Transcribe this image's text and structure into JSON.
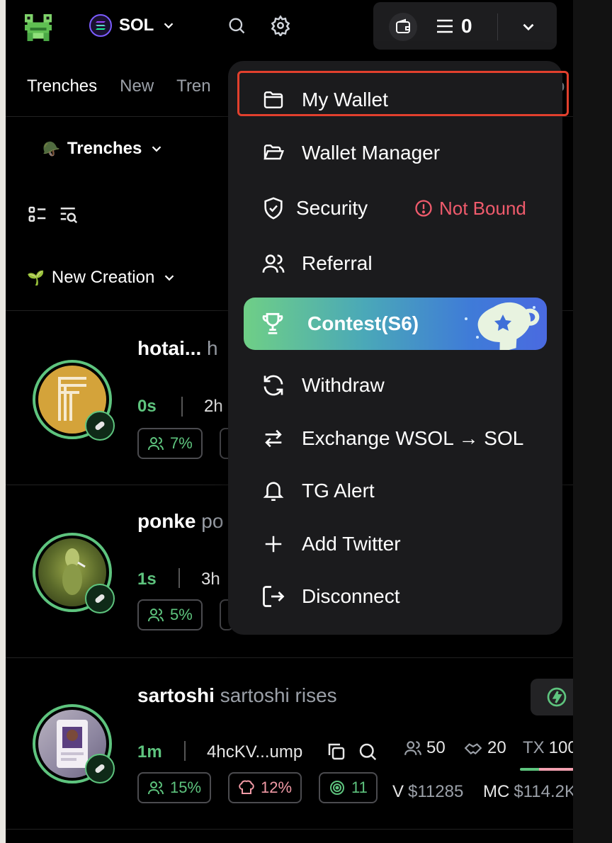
{
  "header": {
    "chain": "SOL",
    "wallet_count": "0"
  },
  "tabs": [
    "Trenches",
    "New",
    "Tren"
  ],
  "tab_edge": "o",
  "filters": {
    "trench_select": "Trenches",
    "trench_emoji": "🪖",
    "creation_select": "New Creation",
    "creation_emoji": "🌱"
  },
  "menu": {
    "items": [
      {
        "label": "My Wallet",
        "icon": "folder-icon"
      },
      {
        "label": "Wallet Manager",
        "icon": "folder-open-icon"
      },
      {
        "label": "Security",
        "icon": "shield-check-icon",
        "warning": "Not Bound"
      },
      {
        "label": "Referral",
        "icon": "users-icon"
      },
      {
        "label": "Contest(S6)",
        "icon": "trophy-icon"
      },
      {
        "label": "Withdraw",
        "icon": "refresh-icon"
      },
      {
        "label": "Exchange WSOL → SOL",
        "icon": "arrows-swap-icon"
      },
      {
        "label": "TG Alert",
        "icon": "bell-icon"
      },
      {
        "label": "Add Twitter",
        "icon": "plus-icon"
      },
      {
        "label": "Disconnect",
        "icon": "logout-icon"
      }
    ]
  },
  "tokens": [
    {
      "name": "hotai...",
      "sub": "h",
      "age": "0s",
      "meta": "2h",
      "holders_pct": "7%"
    },
    {
      "name": "ponke",
      "sub": "po",
      "age": "1s",
      "meta": "3h",
      "holders_pct": "5%"
    },
    {
      "name": "sartoshi",
      "sub": "sartoshi rises",
      "age": "1m",
      "meta": "4hcKV...ump",
      "holders_pct": "15%",
      "dev_pct": "12%",
      "snipers": "11",
      "holders": "50",
      "hands": "20",
      "tx_label": "TX",
      "tx": "100",
      "volume_label": "V",
      "volume": "$11285",
      "mc_label": "MC",
      "mc": "$114.2K"
    }
  ],
  "colors": {
    "accent_green": "#5ec47e",
    "warning_red": "#ef5b6c",
    "highlight_border": "#e2402d"
  }
}
